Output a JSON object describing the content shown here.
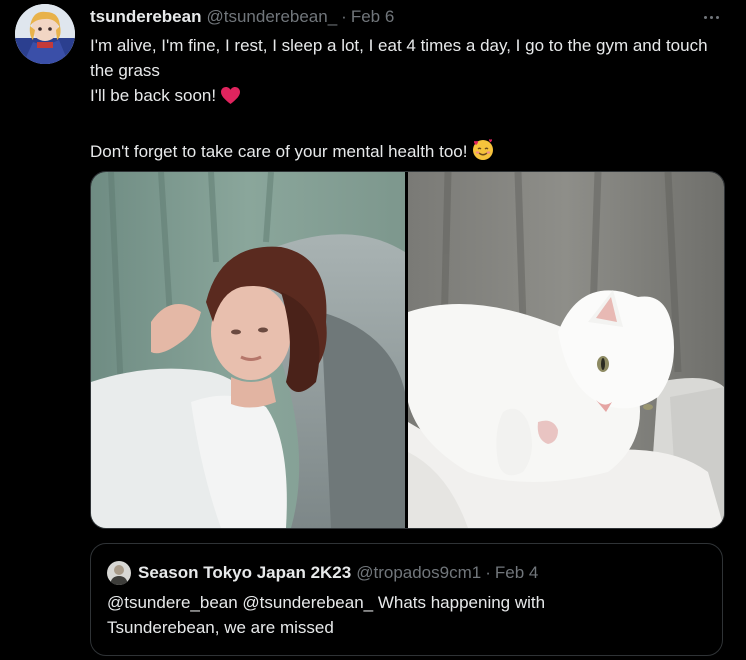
{
  "tweet": {
    "display_name": "tsunderebean",
    "handle": "@tsunderebean_",
    "separator": "·",
    "date": "Feb 6",
    "text_line_1": "I'm alive, I'm fine, I rest, I sleep a lot, I eat 4 times a day, I go to the gym and touch the grass",
    "text_line_2": "I'll be back soon!",
    "text_line_3": "Don't forget to take care of your mental health too!",
    "media": [
      {
        "icon": "photo-woman-lying-on-couch"
      },
      {
        "icon": "photo-white-cat-on-blanket"
      }
    ]
  },
  "quoted_tweet": {
    "display_name": "Season Tokyo Japan 2K23",
    "handle": "@tropados9cm1",
    "separator": "·",
    "date": "Feb 4",
    "text_line_1": "@tsundere_bean  @tsunderebean_  Whats happening with",
    "text_line_2": "Tsunderebean, we are missed"
  },
  "icons": {
    "more": "more-horizontal-icon",
    "heart": "red-heart-emoji",
    "smiling_hearts": "smiling-face-with-hearts-emoji"
  },
  "colors": {
    "background": "#000000",
    "primary_text": "#e7e9ea",
    "secondary_text": "#71767b",
    "border": "#2f3336",
    "heart": "#f91880"
  }
}
